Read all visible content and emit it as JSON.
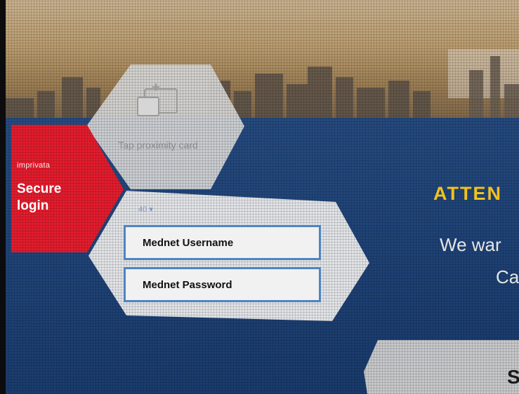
{
  "brand": {
    "name": "imprivata"
  },
  "login": {
    "title": "Secure login"
  },
  "tap_card": {
    "label": "Tap proximity card",
    "icon": "proximity-card-icon"
  },
  "domain": {
    "value": "40"
  },
  "fields": {
    "username_placeholder": "Mednet Username",
    "password_placeholder": "Mednet Password"
  },
  "notice": {
    "title": "ATTEN",
    "line1": "We war",
    "line2": "Ca"
  },
  "bottom_button": {
    "label": "S"
  },
  "colors": {
    "accent_red": "#e31c2d",
    "field_border": "#4f84c2",
    "attention_yellow": "#f2c11c",
    "background_blue": "#1d3f72"
  }
}
